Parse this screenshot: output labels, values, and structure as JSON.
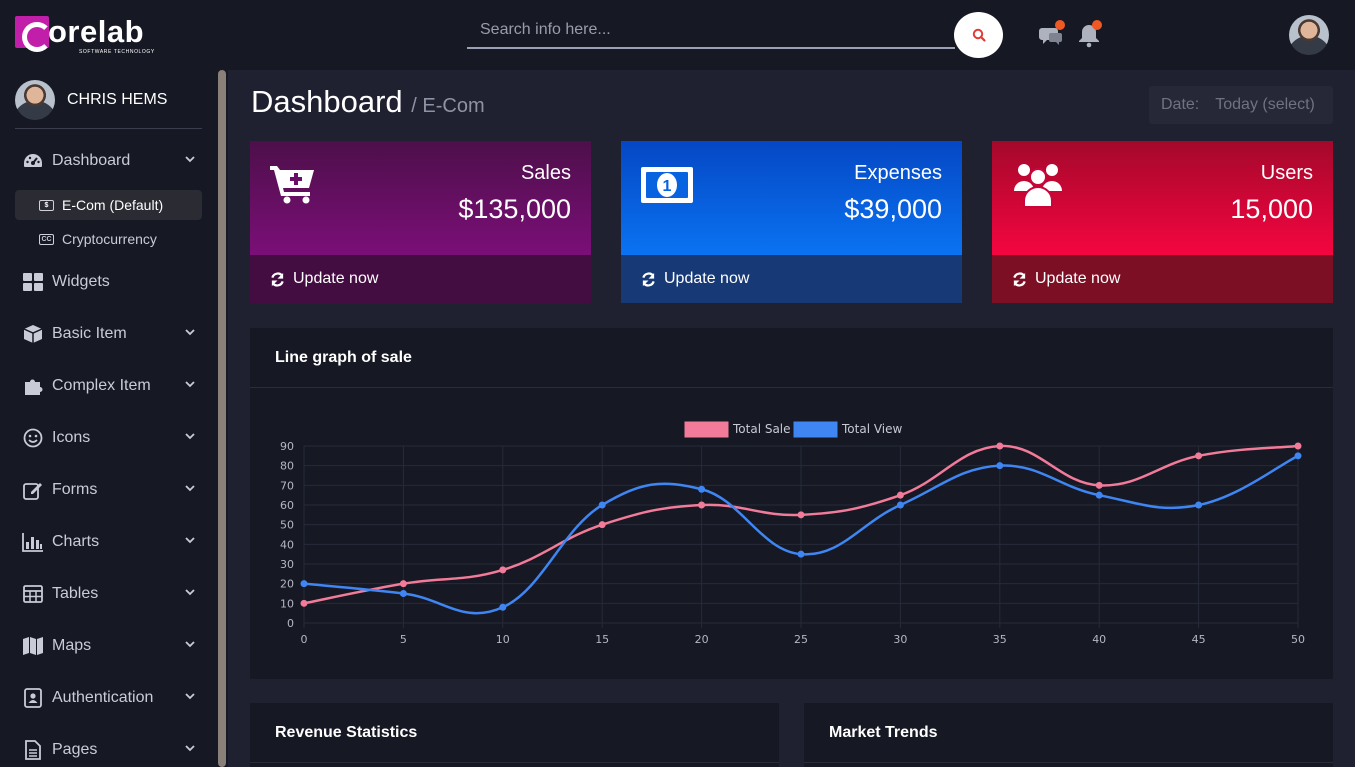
{
  "brand": {
    "logo_text": "orelab",
    "tagline": "SOFTWARE TECHNOLOGY"
  },
  "search": {
    "placeholder": "Search info here..."
  },
  "header": {
    "icons": [
      "search-icon",
      "chat-icon",
      "bell-icon"
    ],
    "notification_dot_color": "#ef5a24"
  },
  "user": {
    "name": "CHRIS HEMS"
  },
  "sidebar": {
    "items": [
      {
        "label": "Dashboard",
        "icon": "gauge-icon",
        "has_chevron": true
      },
      {
        "label": "Widgets",
        "icon": "grid-icon",
        "has_chevron": false
      },
      {
        "label": "Basic Item",
        "icon": "cube-icon",
        "has_chevron": true
      },
      {
        "label": "Complex Item",
        "icon": "puzzle-icon",
        "has_chevron": true
      },
      {
        "label": "Icons",
        "icon": "smile-icon",
        "has_chevron": true
      },
      {
        "label": "Forms",
        "icon": "forms-icon",
        "has_chevron": true
      },
      {
        "label": "Charts",
        "icon": "bar-chart-icon",
        "has_chevron": true
      },
      {
        "label": "Tables",
        "icon": "table-icon",
        "has_chevron": true
      },
      {
        "label": "Maps",
        "icon": "map-icon",
        "has_chevron": true
      },
      {
        "label": "Authentication",
        "icon": "id-card-icon",
        "has_chevron": true
      },
      {
        "label": "Pages",
        "icon": "file-icon",
        "has_chevron": true
      }
    ],
    "dashboard_sub": [
      {
        "label": "E-Com (Default)",
        "icon": "money-icon",
        "active": true
      },
      {
        "label": "Cryptocurrency",
        "icon": "cc-icon",
        "active": false
      }
    ]
  },
  "page": {
    "title": "Dashboard",
    "subtitle": "/ E-Com"
  },
  "date_filter": {
    "label": "Date:",
    "value": "Today (select)"
  },
  "cards": [
    {
      "title": "Sales",
      "value": "$135,000",
      "action": "Update now",
      "icon": "cart-plus-icon",
      "colors": [
        "#4d0f4a",
        "#7b0f78",
        "#440d42"
      ]
    },
    {
      "title": "Expenses",
      "value": "$39,000",
      "action": "Update now",
      "icon": "money-bill-icon",
      "colors": [
        "#0547c4",
        "#0a73f2",
        "#173a77"
      ]
    },
    {
      "title": "Users",
      "value": "15,000",
      "action": "Update now",
      "icon": "users-icon",
      "colors": [
        "#a4082b",
        "#f50540",
        "#7d0f24"
      ]
    }
  ],
  "line_panel": {
    "title": "Line graph of sale"
  },
  "revenue_panel": {
    "title": "Revenue Statistics"
  },
  "market_panel": {
    "title": "Market Trends"
  },
  "chart_data": {
    "type": "line",
    "x": [
      0,
      5,
      10,
      15,
      20,
      25,
      30,
      35,
      40,
      45,
      50
    ],
    "series": [
      {
        "name": "Total Sale",
        "color": "#f27b9a",
        "values": [
          10,
          20,
          27,
          50,
          60,
          55,
          65,
          90,
          70,
          85,
          90
        ]
      },
      {
        "name": "Total View",
        "color": "#3f86f2",
        "values": [
          20,
          15,
          8,
          60,
          68,
          35,
          60,
          80,
          65,
          60,
          85
        ]
      }
    ],
    "y_ticks": [
      0,
      10,
      20,
      30,
      40,
      50,
      60,
      70,
      80,
      90
    ],
    "ylim": [
      0,
      90
    ],
    "xlim": [
      0,
      50
    ],
    "grid": true,
    "legend": "top-center"
  }
}
